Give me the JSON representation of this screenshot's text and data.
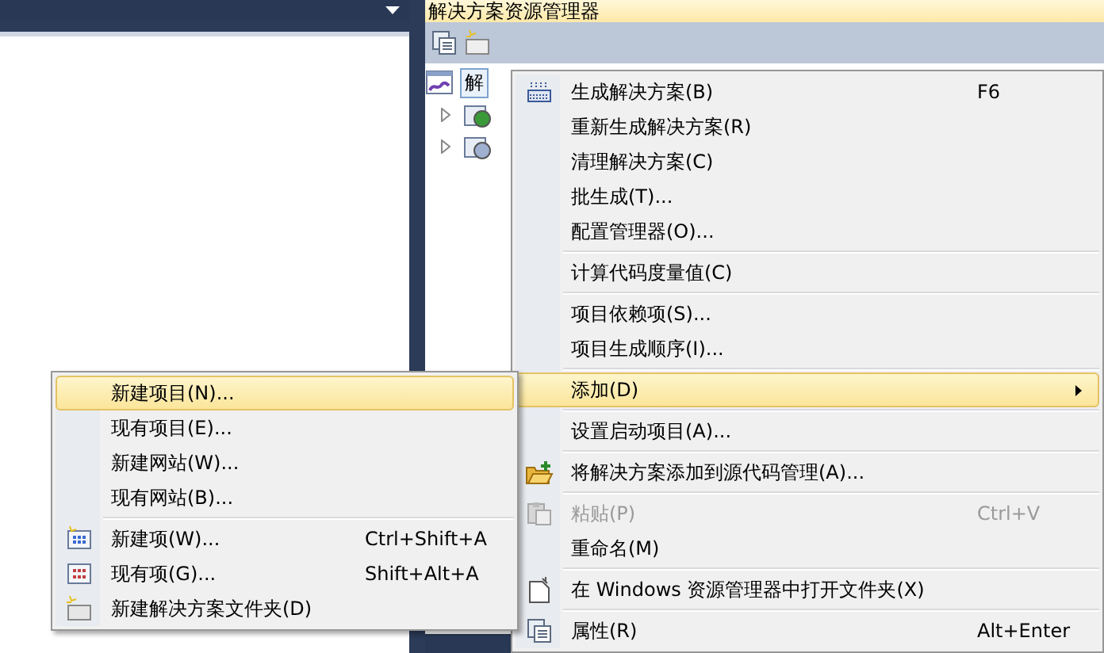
{
  "solution_explorer": {
    "title": "解决方案资源管理器",
    "tree": [
      {
        "label": "解",
        "selected": true,
        "children": [
          {
            "expanded": false
          },
          {
            "expanded": false
          }
        ]
      }
    ]
  },
  "context_menu": {
    "items": [
      {
        "kind": "item",
        "label": "生成解决方案(B)",
        "shortcut": "F6",
        "selected": false,
        "disabled": false
      },
      {
        "kind": "item",
        "label": "重新生成解决方案(R)",
        "selected": false,
        "disabled": false
      },
      {
        "kind": "item",
        "label": "清理解决方案(C)",
        "selected": false,
        "disabled": false
      },
      {
        "kind": "item",
        "label": "批生成(T)...",
        "selected": false,
        "disabled": false
      },
      {
        "kind": "item",
        "label": "配置管理器(O)...",
        "selected": false,
        "disabled": false
      },
      {
        "kind": "separator"
      },
      {
        "kind": "item",
        "label": "计算代码度量值(C)",
        "selected": false,
        "disabled": false
      },
      {
        "kind": "separator"
      },
      {
        "kind": "item",
        "label": "项目依赖项(S)...",
        "selected": false,
        "disabled": false
      },
      {
        "kind": "item",
        "label": "项目生成顺序(I)...",
        "selected": false,
        "disabled": false
      },
      {
        "kind": "separator"
      },
      {
        "kind": "submenu",
        "label": "添加(D)",
        "selected": true,
        "disabled": false
      },
      {
        "kind": "separator"
      },
      {
        "kind": "item",
        "label": "设置启动项目(A)...",
        "selected": false,
        "disabled": false
      },
      {
        "kind": "separator"
      },
      {
        "kind": "item",
        "label": "将解决方案添加到源代码管理(A)...",
        "selected": false,
        "disabled": false
      },
      {
        "kind": "separator"
      },
      {
        "kind": "item",
        "label": "粘贴(P)",
        "shortcut": "Ctrl+V",
        "selected": false,
        "disabled": true
      },
      {
        "kind": "item",
        "label": "重命名(M)",
        "selected": false,
        "disabled": false
      },
      {
        "kind": "separator"
      },
      {
        "kind": "item",
        "label": "在 Windows 资源管理器中打开文件夹(X)",
        "selected": false,
        "disabled": false
      },
      {
        "kind": "separator"
      },
      {
        "kind": "item",
        "label": "属性(R)",
        "shortcut": "Alt+Enter",
        "selected": false,
        "disabled": false
      }
    ]
  },
  "submenu": {
    "items": [
      {
        "kind": "item",
        "label": "新建项目(N)...",
        "selected": true,
        "disabled": false
      },
      {
        "kind": "item",
        "label": "现有项目(E)...",
        "selected": false,
        "disabled": false
      },
      {
        "kind": "item",
        "label": "新建网站(W)...",
        "selected": false,
        "disabled": false
      },
      {
        "kind": "item",
        "label": "现有网站(B)...",
        "selected": false,
        "disabled": false
      },
      {
        "kind": "separator"
      },
      {
        "kind": "item",
        "label": "新建项(W)...",
        "shortcut": "Ctrl+Shift+A",
        "selected": false,
        "disabled": false
      },
      {
        "kind": "item",
        "label": "现有项(G)...",
        "shortcut": "Shift+Alt+A",
        "selected": false,
        "disabled": false
      },
      {
        "kind": "item",
        "label": "新建解决方案文件夹(D)",
        "selected": false,
        "disabled": false
      }
    ]
  }
}
